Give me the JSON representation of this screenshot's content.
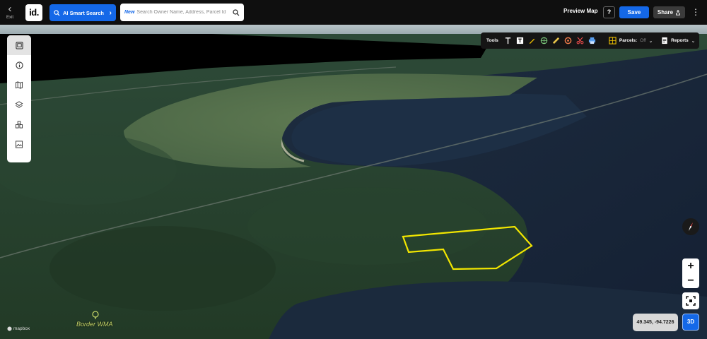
{
  "topbar": {
    "exit_label": "Exit",
    "logo_text": "id.",
    "ai_search_label": "AI Smart Search",
    "search_badge": "New",
    "search_placeholder": "Search Owner Name, Address, Parcel Id",
    "preview_label": "Preview Map",
    "help_label": "?",
    "save_label": "Save",
    "share_label": "Share"
  },
  "left_toolbar": {
    "items": [
      {
        "icon": "layout-panel-icon",
        "active": true
      },
      {
        "icon": "info-icon",
        "active": false
      },
      {
        "icon": "map-icon",
        "active": false
      },
      {
        "icon": "layers-icon",
        "active": false
      },
      {
        "icon": "buildings-icon",
        "active": false
      },
      {
        "icon": "image-export-icon",
        "active": false
      }
    ]
  },
  "tools_bar": {
    "tools_label": "Tools",
    "parcels_label": "Parcels:",
    "parcels_state": "Off",
    "reports_label": "Reports"
  },
  "map": {
    "poi_label": "Border WMA",
    "attribution": "mapbox",
    "coordinates": "49.345, -94.7226",
    "view_mode": "3D",
    "parcel_outline_color": "#f2e600"
  },
  "colors": {
    "accent": "#1468e8",
    "topbar_bg": "#0f0f0f"
  }
}
